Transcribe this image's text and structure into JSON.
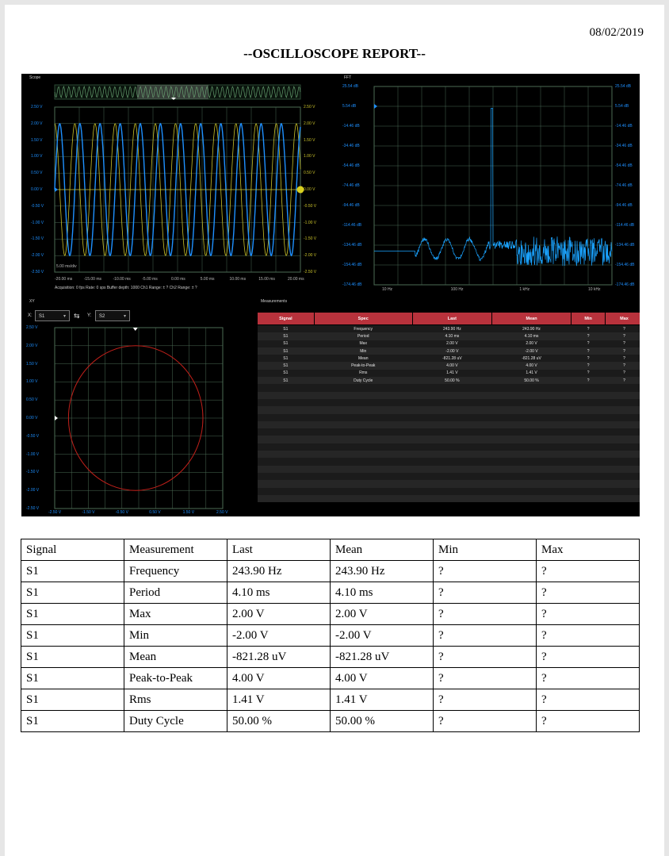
{
  "report": {
    "date": "08/02/2019",
    "title": "--OSCILLOSCOPE REPORT--"
  },
  "scope_panel": {
    "title": "Scope",
    "y_labels": [
      "2.50 V",
      "2.00 V",
      "1.50 V",
      "1.00 V",
      "0.50 V",
      "0.00 V",
      "-0.50 V",
      "-1.00 V",
      "-1.50 V",
      "-2.00 V",
      "-2.50 V"
    ],
    "x_labels": [
      "-20.00 ms",
      "-15.00 ms",
      "-10.00 ms",
      "-5.00 ms",
      "0.00 ms",
      "5.00 ms",
      "10.00 ms",
      "15.00 ms",
      "20.00 ms"
    ],
    "scale_note": "5.00 ms/div",
    "status": "Acquisition: 0 fps   Rate: 0 sps   Buffer depth: 1000   Ch1 Range: ± ?   Ch2 Range: ± ?"
  },
  "fft_panel": {
    "title": "FFT",
    "y_labels": [
      "25.54 dB",
      "5.54 dB",
      "-14.46 dB",
      "-34.46 dB",
      "-54.46 dB",
      "-74.46 dB",
      "-94.46 dB",
      "-114.46 dB",
      "-134.46 dB",
      "-154.46 dB",
      "-174.46 dB"
    ],
    "x_labels": [
      "10 Hz",
      "100 Hz",
      "1 kHz",
      "10 kHz"
    ]
  },
  "xy_panel": {
    "title": "XY",
    "x_prefix": "X:",
    "x_channel": "S1",
    "y_prefix": "Y:",
    "y_channel": "S2",
    "y_labels": [
      "2.50 V",
      "2.00 V",
      "1.50 V",
      "1.00 V",
      "0.50 V",
      "0.00 V",
      "-0.50 V",
      "-1.00 V",
      "-1.50 V",
      "-2.00 V",
      "-2.50 V"
    ],
    "x_labels": [
      "-2.50 V",
      "-1.50 V",
      "-0.50 V",
      "0.50 V",
      "1.50 V",
      "2.50 V"
    ]
  },
  "measurements_panel": {
    "title": "Measurements",
    "headers": [
      "Signal",
      "Spec",
      "Last",
      "Mean",
      "Min",
      "Max"
    ],
    "rows": [
      [
        "S1",
        "Frequency",
        "243.90 Hz",
        "243.90 Hz",
        "?",
        "?"
      ],
      [
        "S1",
        "Period",
        "4.10 ms",
        "4.10 ms",
        "?",
        "?"
      ],
      [
        "S1",
        "Max",
        "2.00 V",
        "2.00 V",
        "?",
        "?"
      ],
      [
        "S1",
        "Min",
        "-2.00 V",
        "-2.00 V",
        "?",
        "?"
      ],
      [
        "S1",
        "Mean",
        "-821.28 uV",
        "-821.28 uV",
        "?",
        "?"
      ],
      [
        "S1",
        "Peak-to-Peak",
        "4.00 V",
        "4.00 V",
        "?",
        "?"
      ],
      [
        "S1",
        "Rms",
        "1.41 V",
        "1.41 V",
        "?",
        "?"
      ],
      [
        "S1",
        "Duty Cycle",
        "50.00 %",
        "50.00 %",
        "?",
        "?"
      ]
    ]
  },
  "table": {
    "headers": [
      "Signal",
      "Measurement",
      "Last",
      "Mean",
      "Min",
      "Max"
    ],
    "rows": [
      [
        "S1",
        "Frequency",
        "243.90 Hz",
        "243.90 Hz",
        "?",
        "?"
      ],
      [
        "S1",
        "Period",
        "4.10 ms",
        "4.10 ms",
        "?",
        "?"
      ],
      [
        "S1",
        "Max",
        "2.00 V",
        "2.00 V",
        "?",
        "?"
      ],
      [
        "S1",
        "Min",
        "-2.00 V",
        "-2.00 V",
        "?",
        "?"
      ],
      [
        "S1",
        "Mean",
        "-821.28 uV",
        "-821.28 uV",
        "?",
        "?"
      ],
      [
        "S1",
        "Peak-to-Peak",
        "4.00 V",
        "4.00 V",
        "?",
        "?"
      ],
      [
        "S1",
        "Rms",
        "1.41 V",
        "1.41 V",
        "?",
        "?"
      ],
      [
        "S1",
        "Duty Cycle",
        "50.00 %",
        "50.00 %",
        "?",
        "?"
      ]
    ]
  },
  "colors": {
    "ch1": "#1e90ff",
    "ch2": "#c8c02a",
    "xy_trace": "#c0201a",
    "grid": "#4b6b55",
    "header_red": "#b8323c"
  }
}
